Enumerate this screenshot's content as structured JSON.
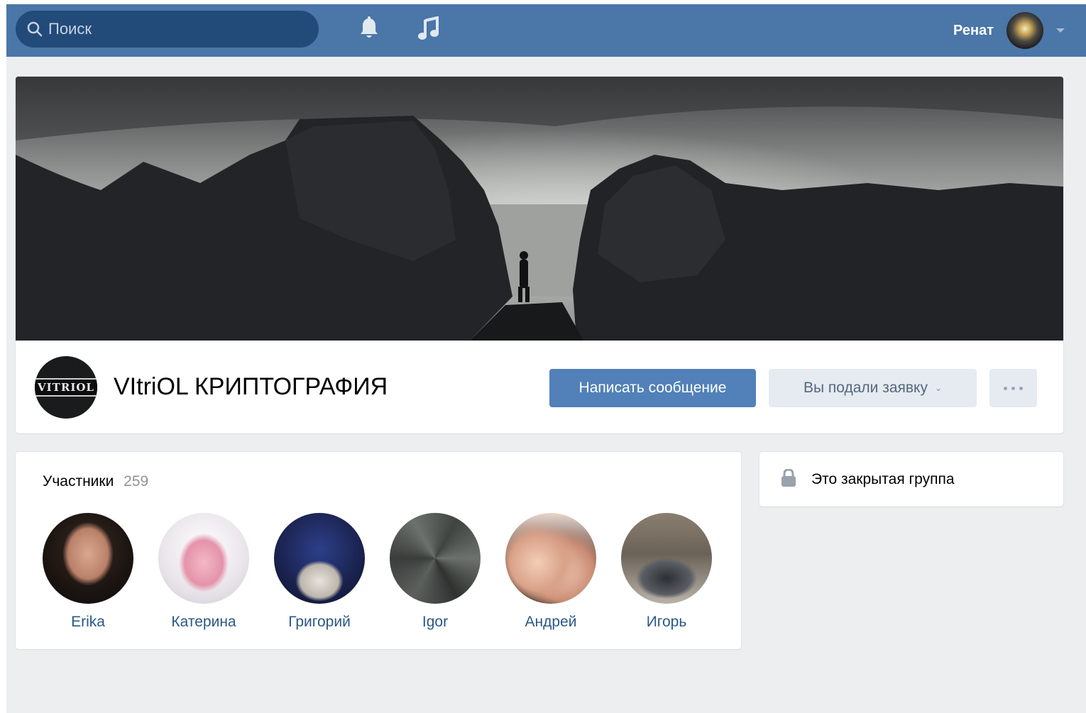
{
  "search": {
    "placeholder": "Поиск"
  },
  "header": {
    "user_name": "Ренат"
  },
  "group": {
    "logo_text": "VITRIOL",
    "title": "VItriOL КРИПТОГРАФИЯ",
    "write_button": "Написать сообщение",
    "request_button": "Вы подали заявку",
    "request_chevron": "⌄"
  },
  "members": {
    "title": "Участники",
    "count": "259",
    "items": [
      {
        "name": "Erika"
      },
      {
        "name": "Катерина"
      },
      {
        "name": "Григорий"
      },
      {
        "name": "Igor"
      },
      {
        "name": "Андрей"
      },
      {
        "name": "Игорь"
      }
    ]
  },
  "closed_group": {
    "text": "Это закрытая группа"
  },
  "colors": {
    "header": "#4a76a8",
    "primary_button": "#5181b8",
    "secondary_button": "#e5ebf1",
    "link": "#2a5885",
    "page_bg": "#edeef0"
  },
  "icons": [
    "search-icon",
    "bell-icon",
    "music-icon",
    "chevron-down-icon",
    "more-icon",
    "lock-icon"
  ]
}
